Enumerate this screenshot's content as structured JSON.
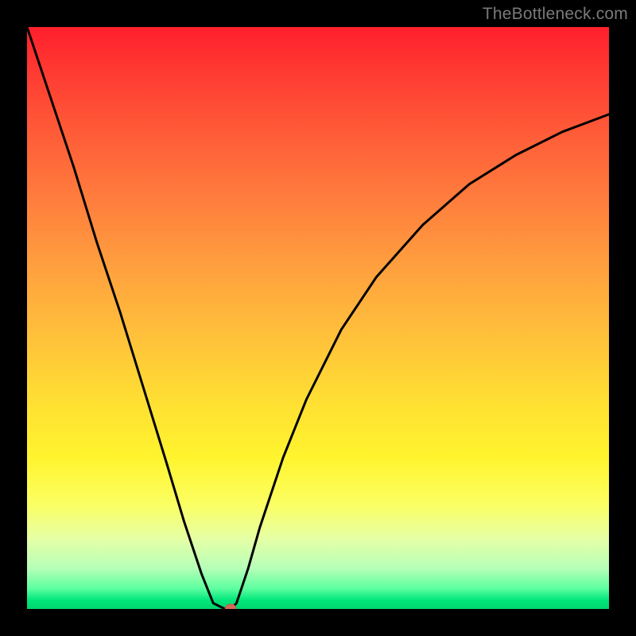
{
  "watermark": "TheBottleneck.com",
  "chart_data": {
    "type": "line",
    "title": "",
    "xlabel": "",
    "ylabel": "",
    "xlim": [
      0,
      100
    ],
    "ylim": [
      0,
      100
    ],
    "grid": false,
    "legend": false,
    "background_gradient": {
      "stops": [
        {
          "pos": 0.0,
          "color": "#ff1f2c"
        },
        {
          "pos": 0.5,
          "color": "#ffc33a"
        },
        {
          "pos": 0.8,
          "color": "#fbff62"
        },
        {
          "pos": 0.97,
          "color": "#5cff9f"
        },
        {
          "pos": 1.0,
          "color": "#00d66f"
        }
      ]
    },
    "series": [
      {
        "name": "bottleneck-curve",
        "color": "#000000",
        "x": [
          0,
          4,
          8,
          12,
          16,
          20,
          24,
          27,
          30,
          32,
          34,
          35,
          36,
          38,
          40,
          44,
          48,
          54,
          60,
          68,
          76,
          84,
          92,
          100
        ],
        "y": [
          100,
          88,
          76,
          63,
          51,
          38,
          25,
          15,
          6,
          1,
          0,
          0,
          1,
          7,
          14,
          26,
          36,
          48,
          57,
          66,
          73,
          78,
          82,
          85
        ]
      }
    ],
    "marker": {
      "name": "optimal-point",
      "x": 35,
      "y": 0,
      "color": "#d46a5a",
      "radius_px": 6
    }
  }
}
